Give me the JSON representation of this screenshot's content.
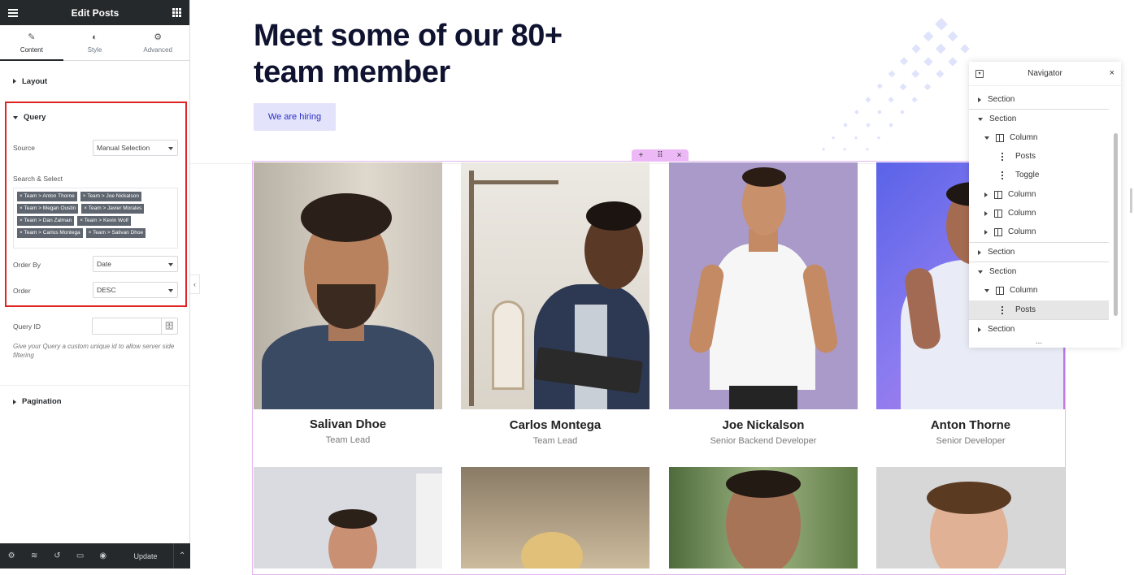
{
  "panel": {
    "title": "Edit Posts",
    "tabs": [
      {
        "label": "Content",
        "icon": "pencil-icon"
      },
      {
        "label": "Style",
        "icon": "half-circle-icon"
      },
      {
        "label": "Advanced",
        "icon": "gear-icon"
      }
    ],
    "layout_label": "Layout",
    "query": {
      "title": "Query",
      "source_label": "Source",
      "source_value": "Manual Selection",
      "search_label": "Search & Select",
      "tags": [
        "× Team > Anton Thorne",
        "× Team > Joe Nickalson",
        "× Team > Megan Oustin",
        "× Team > Javier Morales",
        "× Team > Dan Zalman",
        "× Team > Kevin Wolf",
        "× Team > Carlos Montega",
        "× Team > Salivan Dhoe"
      ],
      "order_by_label": "Order By",
      "order_by_value": "Date",
      "order_label": "Order",
      "order_value": "DESC"
    },
    "query_id_label": "Query ID",
    "query_id_help": "Give your Query a custom unique id to allow server side filtering",
    "pagination_label": "Pagination",
    "footer": {
      "update_label": "Update"
    }
  },
  "canvas": {
    "headline": "Meet some of our 80+ team member",
    "hiring_button": "We are hiring",
    "handles": {
      "add": "+",
      "move": "⠿",
      "close": "×"
    },
    "team": [
      {
        "name": "Salivan Dhoe",
        "role": "Team Lead"
      },
      {
        "name": "Carlos Montega",
        "role": "Team Lead"
      },
      {
        "name": "Joe Nickalson",
        "role": "Senior Backend Developer"
      },
      {
        "name": "Anton Thorne",
        "role": "Senior Developer"
      }
    ]
  },
  "navigator": {
    "title": "Navigator",
    "items": [
      {
        "label": "Section"
      },
      {
        "label": "Section"
      },
      {
        "label": "Column"
      },
      {
        "label": "Posts"
      },
      {
        "label": "Toggle"
      },
      {
        "label": "Column"
      },
      {
        "label": "Column"
      },
      {
        "label": "Column"
      },
      {
        "label": "Section"
      },
      {
        "label": "Section"
      },
      {
        "label": "Column"
      },
      {
        "label": "Posts"
      },
      {
        "label": "Section"
      }
    ],
    "more": "..."
  },
  "colors": {
    "panel_dark": "#26292c",
    "query_highlight": "#e02424",
    "headline": "#0f1330",
    "hiring_bg": "#e3e3fb",
    "hiring_text": "#2b2fc4",
    "widget_outline": "#e3b6f0"
  }
}
